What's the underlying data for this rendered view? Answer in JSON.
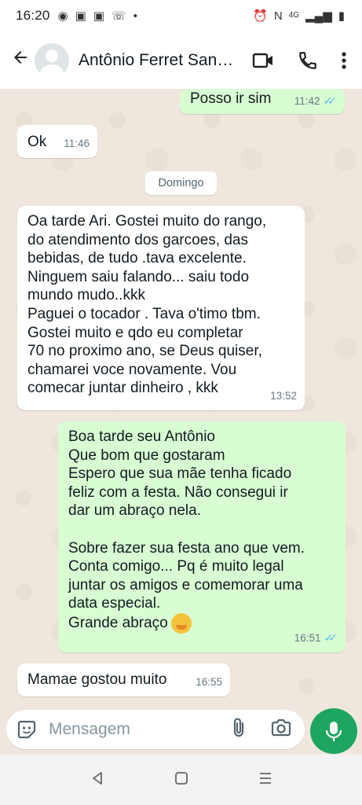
{
  "status_bar": {
    "time": "16:20",
    "network": "4G"
  },
  "header": {
    "contact_name": "Antônio Ferret Santos"
  },
  "chat": {
    "date_separator": "Domingo",
    "messages": [
      {
        "direction": "out",
        "text": "Posso ir sim",
        "time": "11:42",
        "read": true
      },
      {
        "direction": "in",
        "text": "Ok",
        "time": "11:46"
      },
      {
        "direction": "in",
        "text": "Oa tarde Ari. Gostei muito do rango,\ndo atendimento dos garcoes, das\nbebidas, de tudo .tava excelente.\nNinguem saiu falando... saiu todo\nmundo mudo..kkk\nPaguei o tocador . Tava o'timo tbm.\nGostei muito e qdo eu completar\n70 no proximo ano, se Deus quiser,\nchamarei voce novamente. Vou\ncomecar juntar dinheiro , kkk",
        "time": "13:52"
      },
      {
        "direction": "out",
        "text": "Boa tarde seu Antônio\nQue bom que gostaram\nEspero que sua mãe tenha ficado\nfeliz com a festa. Não consegui ir\ndar um abraço nela.\n\nSobre fazer sua festa ano que vem.\nConta comigo... Pq é muito legal\njuntar os amigos e comemorar uma\ndata especial.\nGrande abraço",
        "time": "16:51",
        "read": true,
        "emoji": "hugging-face"
      },
      {
        "direction": "in",
        "text": "Mamae gostou muito",
        "time": "16:55"
      }
    ]
  },
  "composer": {
    "placeholder": "Mensagem"
  },
  "colors": {
    "outgoing_bubble": "#d9fdd3",
    "incoming_bubble": "#ffffff",
    "chat_background": "#efe7dd",
    "mic_button": "#1ea55f",
    "read_ticks": "#53bdeb"
  }
}
